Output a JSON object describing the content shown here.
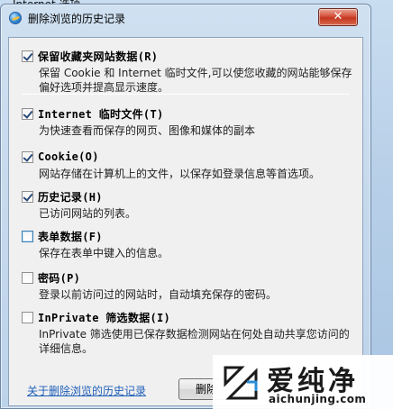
{
  "parent_window": {
    "title": "Internet 选项"
  },
  "dialog": {
    "title": "删除浏览的历史记录",
    "close_label": "✕"
  },
  "options": [
    {
      "label": "保留收藏夹网站数据(R)",
      "checked": true,
      "description": "保留 Cookie 和 Internet 临时文件,可以使您收藏的网站能够保存偏好选项并提高显示速度。"
    },
    {
      "label": "Internet 临时文件(T)",
      "checked": true,
      "description": "为快速查看而保存的网页、图像和媒体的副本"
    },
    {
      "label": "Cookie(O)",
      "checked": true,
      "description": "网站存储在计算机上的文件，以保存如登录信息等首选项。"
    },
    {
      "label": "历史记录(H)",
      "checked": true,
      "description": "已访问网站的列表。"
    },
    {
      "label": "表单数据(F)",
      "checked": false,
      "description": "保存在表单中键入的信息。"
    },
    {
      "label": "密码(P)",
      "checked": false,
      "description": "登录以前访问过的网站时，自动填充保存的密码。"
    },
    {
      "label": "InPrivate 筛选数据(I)",
      "checked": false,
      "description": "InPrivate 筛选使用已保存数据检测网站在何处自动共享您访问的详细信息。"
    }
  ],
  "footer": {
    "help_link": "关于删除浏览的历史记录",
    "delete_button": "删除"
  },
  "watermark": {
    "brand": "爱纯净",
    "url": "aichunjing.com"
  }
}
